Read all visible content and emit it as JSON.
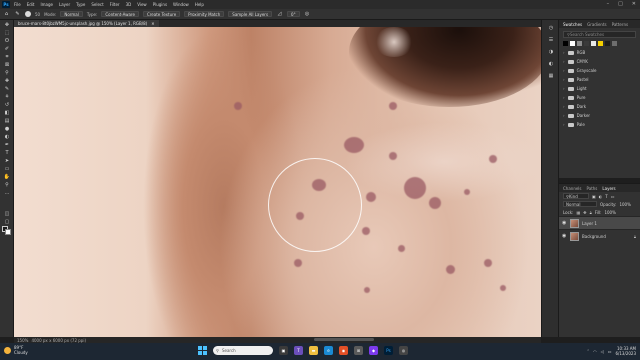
{
  "menubar": {
    "logo": "Ps",
    "items": [
      "File",
      "Edit",
      "Image",
      "Layer",
      "Type",
      "Select",
      "Filter",
      "3D",
      "View",
      "Plugins",
      "Window",
      "Help"
    ]
  },
  "options": {
    "brush_size": "50",
    "mode_label": "Mode:",
    "mode_value": "Normal",
    "type_label": "Type:",
    "content_aware": "Content-Aware",
    "create_texture": "Create Texture",
    "proximity_match": "Proximity Match",
    "sample_all_layers": "Sample All Layers",
    "angle_value": "0°"
  },
  "document": {
    "tab_title": "bruce-mars-8t0jbzWM5jc-unsplash.jpg @ 150% (Layer 1, RGB/8)",
    "status_zoom": "150%",
    "status_size": "4000 px x 6000 px (72 ppi)"
  },
  "swatches_panel": {
    "tabs": [
      "Swatches",
      "Gradients",
      "Patterns"
    ],
    "active_tab": "Swatches",
    "search_placeholder": "Search Swatches",
    "colors": [
      "#000000",
      "#ffffff",
      "#8c8c8c",
      "#3a3a3a",
      "#e8e8e8",
      "#f5d000",
      "#1c1c1c",
      "#6e6e6e"
    ],
    "folders": [
      "RGB",
      "CMYK",
      "Grayscale",
      "Pastel",
      "Light",
      "Pure",
      "Dark",
      "Darker",
      "Pale"
    ]
  },
  "layers_panel": {
    "tabs": [
      "Channels",
      "Paths",
      "Layers"
    ],
    "active_tab": "Layers",
    "kind_placeholder": "Kind",
    "blend_mode": "Normal",
    "opacity_label": "Opacity:",
    "opacity_value": "100%",
    "lock_label": "Lock:",
    "fill_label": "Fill:",
    "fill_value": "100%",
    "layers": [
      {
        "name": "Layer 1",
        "selected": true,
        "locked": false
      },
      {
        "name": "Background",
        "selected": false,
        "locked": true
      }
    ]
  },
  "taskbar": {
    "weather_temp": "89°F",
    "weather_desc": "Cloudy",
    "search_placeholder": "Search",
    "time": "10:33 AM",
    "date": "6/13/2023"
  }
}
